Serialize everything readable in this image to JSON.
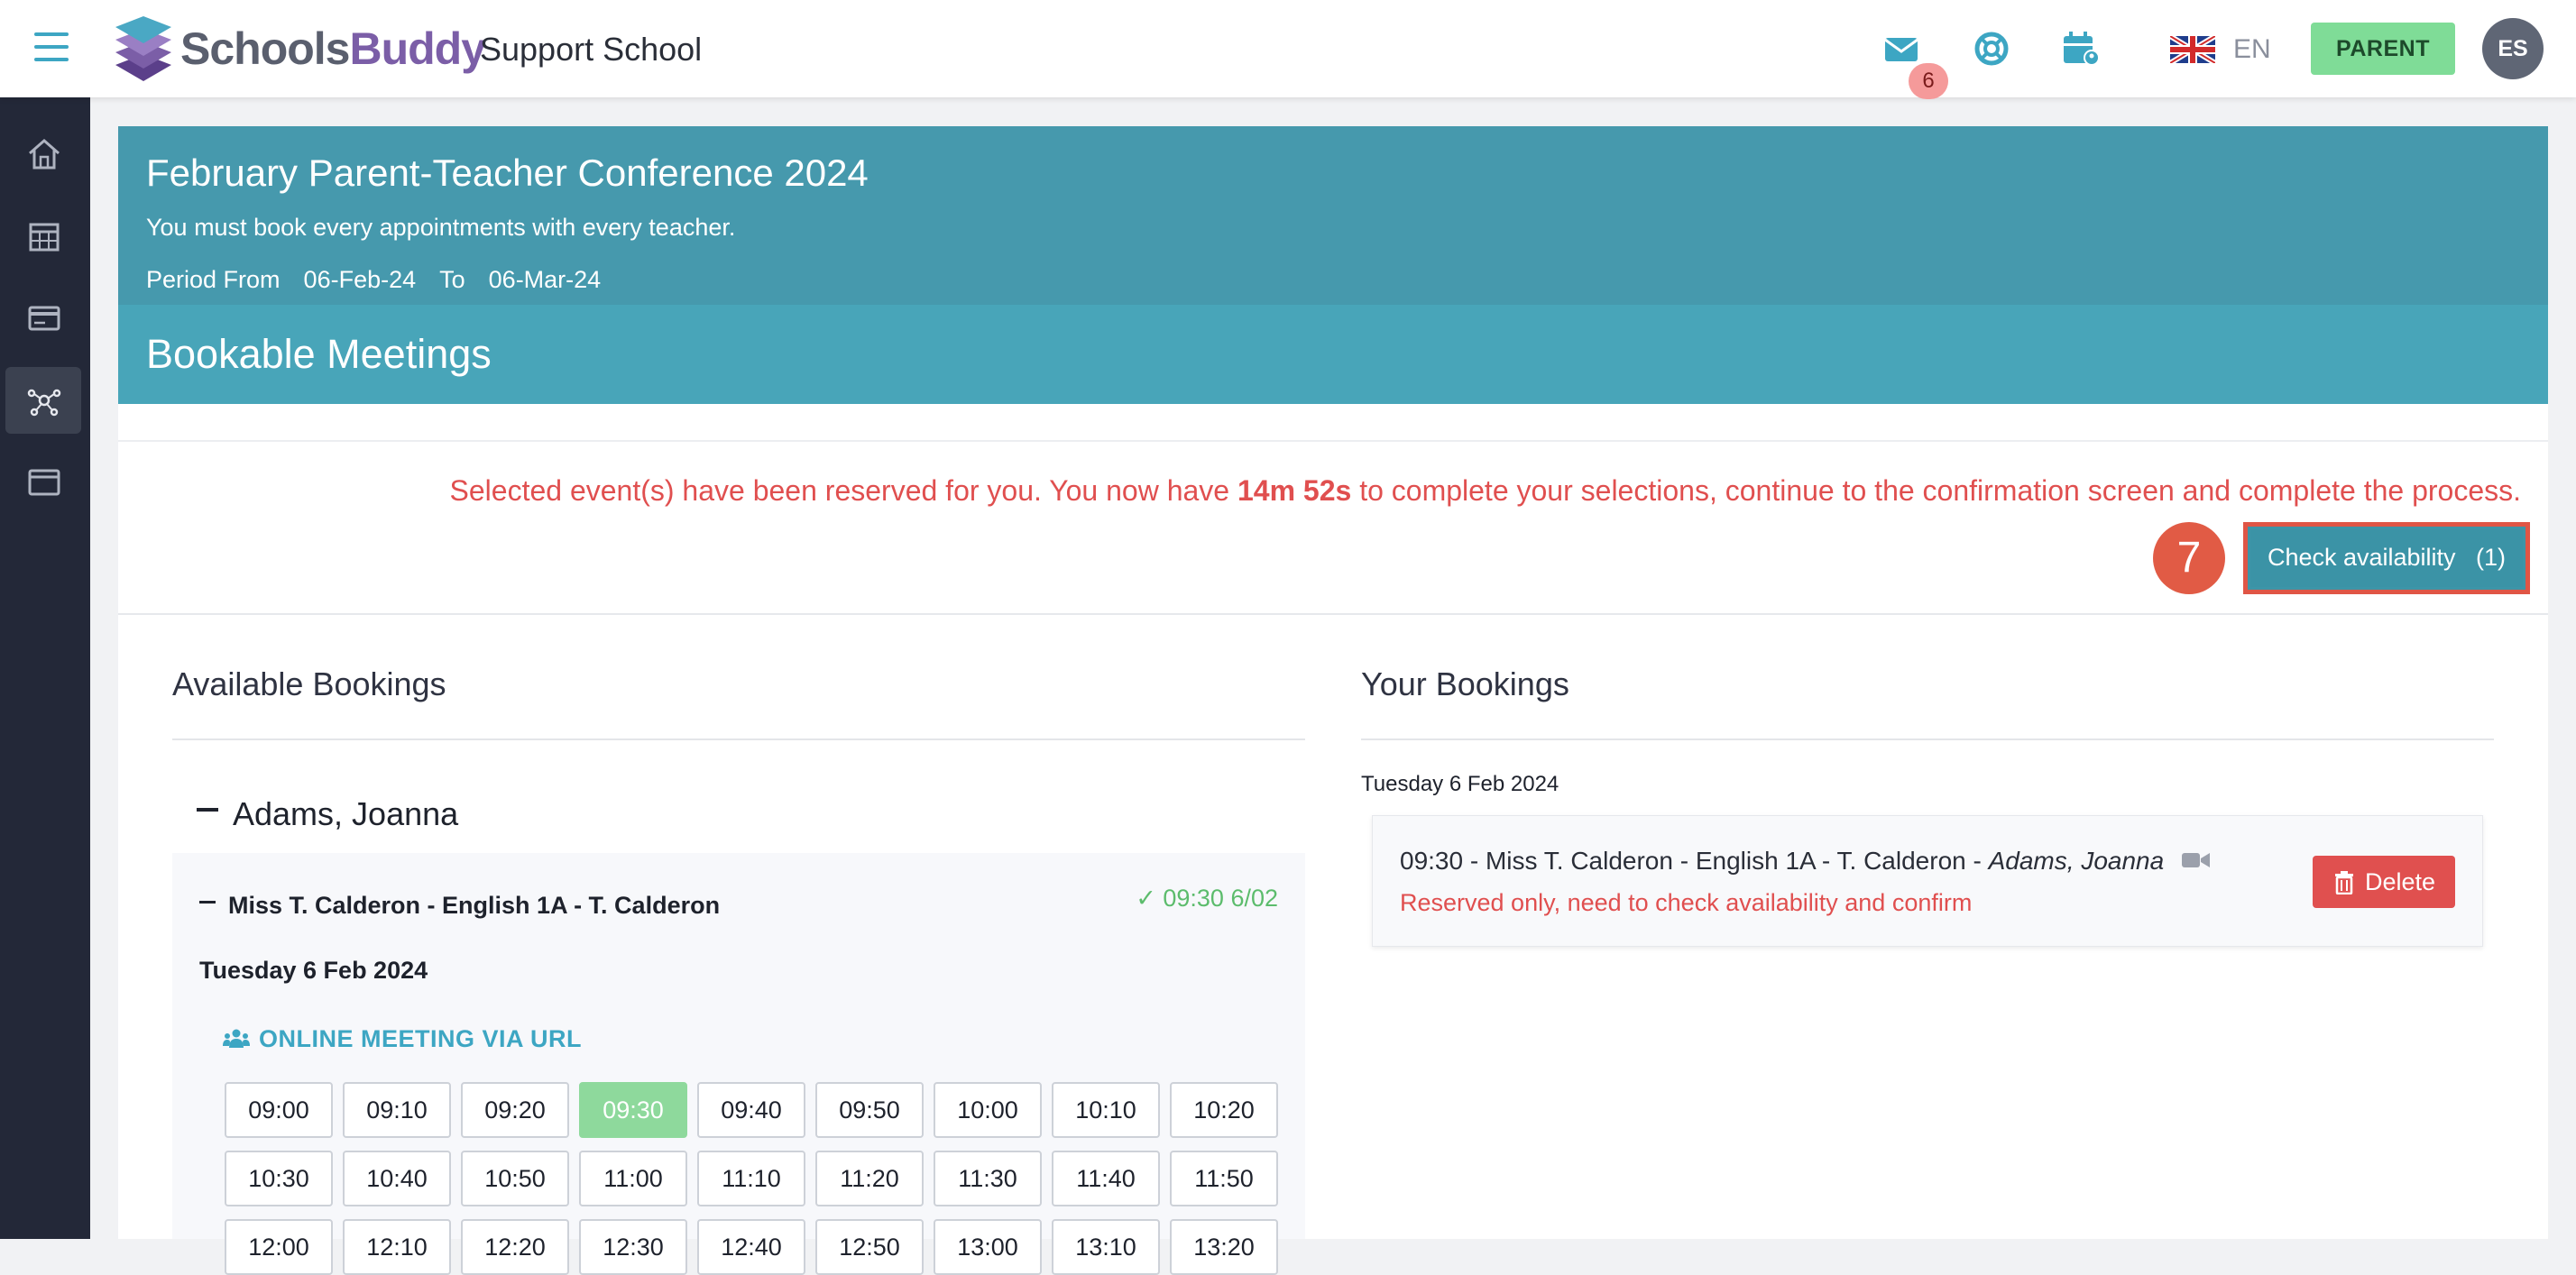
{
  "brand": {
    "name_part1": "Schools",
    "name_part2": "Buddy",
    "school": "Support School"
  },
  "header": {
    "mail_badge": "6",
    "language": "EN",
    "role_button": "PARENT",
    "avatar_initials": "ES"
  },
  "sidebar": {
    "items": [
      {
        "icon": "home-icon"
      },
      {
        "icon": "calendar-icon"
      },
      {
        "icon": "payment-card-icon"
      },
      {
        "icon": "network-icon",
        "active": true
      },
      {
        "icon": "window-icon"
      }
    ]
  },
  "conference": {
    "title": "February Parent-Teacher Conference 2024",
    "subtitle": "You must book every appointments with every teacher.",
    "period_from_label": "Period From",
    "period_from": "06-Feb-24",
    "period_to_label": "To",
    "period_to": "06-Mar-24"
  },
  "bookable": {
    "title": "Bookable Meetings"
  },
  "notice": {
    "text_before": "Selected event(s) have been reserved for you. You now have ",
    "time": "14m 52s",
    "text_after": " to complete your selections, continue to the confirmation screen and complete the process."
  },
  "step_marker": "7",
  "check_button": {
    "label": "Check availability   (1)"
  },
  "available": {
    "title": "Available Bookings",
    "student": "Adams, Joanna",
    "teacher": "Miss T. Calderon - English 1A - T. Calderon",
    "selected_status": "✓ 09:30 6/02",
    "date": "Tuesday 6 Feb 2024",
    "meeting_type": "ONLINE MEETING VIA URL",
    "slots": [
      "09:00",
      "09:10",
      "09:20",
      "09:30",
      "09:40",
      "09:50",
      "10:00",
      "10:10",
      "10:20",
      "10:30",
      "10:40",
      "10:50",
      "11:00",
      "11:10",
      "11:20",
      "11:30",
      "11:40",
      "11:50",
      "12:00",
      "12:10",
      "12:20",
      "12:30",
      "12:40",
      "12:50",
      "13:00",
      "13:10",
      "13:20"
    ],
    "selected_slot": "09:30"
  },
  "your": {
    "title": "Your Bookings",
    "date": "Tuesday 6 Feb 2024",
    "booking_main": "09:30 - Miss T. Calderon - English 1A - T. Calderon - ",
    "booking_student": "Adams, Joanna",
    "warning": "Reserved only, need to check availability and confirm",
    "delete_label": "Delete"
  },
  "colors": {
    "header_panel": "#4699ad",
    "bookable_panel": "#48a5b9",
    "accent_red": "#e04f4f",
    "selected_slot": "#8ed99c",
    "parent_button": "#7fdc97",
    "sidebar": "#232838"
  }
}
